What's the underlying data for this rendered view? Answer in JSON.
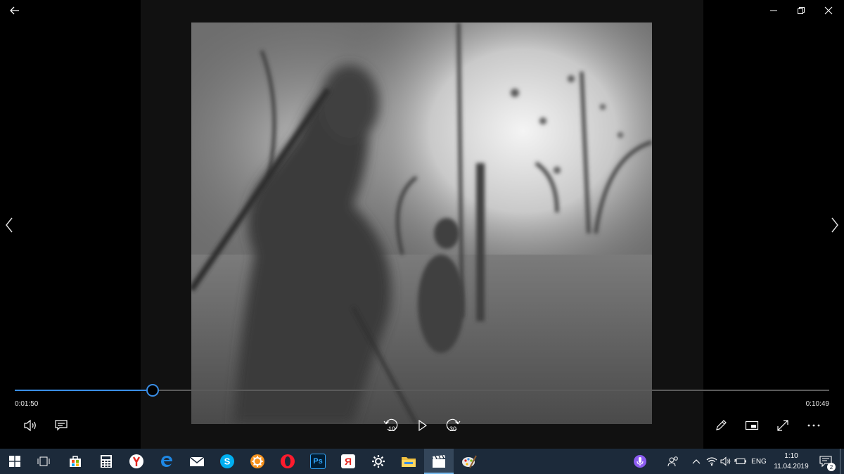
{
  "player": {
    "current_time": "0:01:50",
    "total_time": "0:10:49",
    "progress": 0.1695,
    "skip_back_label": "10",
    "skip_forward_label": "30"
  },
  "taskbar": {
    "lang": "ENG",
    "clock_time": "1:10",
    "clock_date": "11.04.2019",
    "notification_count": "2",
    "apps": [
      "start-icon",
      "task-view-icon",
      "store-icon",
      "calculator-icon",
      "yandex-browser-icon",
      "edge-icon",
      "mail-icon",
      "skype-icon",
      "settings-app-icon",
      "opera-icon",
      "photoshop-icon",
      "yandex-icon",
      "settings-gear-icon",
      "file-explorer-icon",
      "movies-tv-icon",
      "paint-icon"
    ],
    "ps_label": "Ps",
    "ya_label": "Я"
  },
  "colors": {
    "accent": "#3a8ee6",
    "taskbar": "#1c2a3a"
  }
}
